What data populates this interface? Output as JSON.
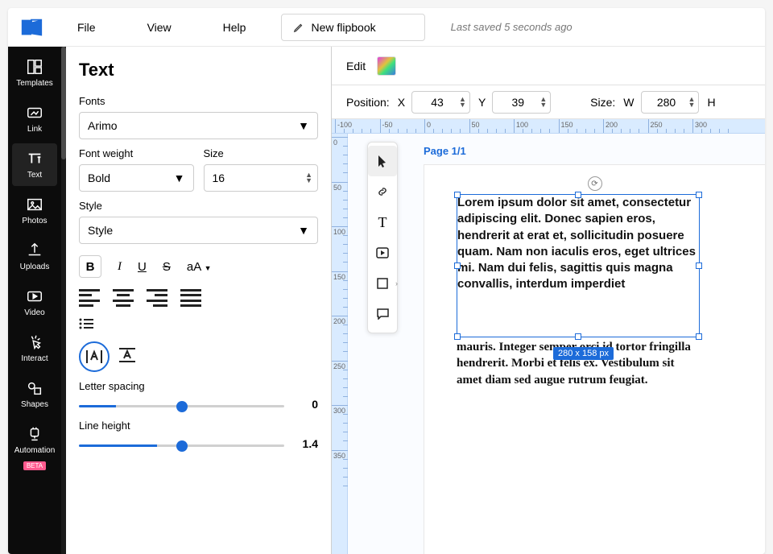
{
  "menubar": {
    "file": "File",
    "view": "View",
    "help": "Help",
    "new_flipbook": "New flipbook",
    "last_saved": "Last saved 5 seconds ago"
  },
  "sidebar": {
    "items": [
      {
        "id": "templates",
        "label": "Templates"
      },
      {
        "id": "link",
        "label": "Link"
      },
      {
        "id": "text",
        "label": "Text"
      },
      {
        "id": "photos",
        "label": "Photos"
      },
      {
        "id": "uploads",
        "label": "Uploads"
      },
      {
        "id": "video",
        "label": "Video"
      },
      {
        "id": "interact",
        "label": "Interact"
      },
      {
        "id": "shapes",
        "label": "Shapes"
      },
      {
        "id": "automation",
        "label": "Automation"
      }
    ],
    "beta_tag": "BETA",
    "active": "text"
  },
  "panel": {
    "title": "Text",
    "fonts_label": "Fonts",
    "font_value": "Arimo",
    "weight_label": "Font weight",
    "weight_value": "Bold",
    "size_label": "Size",
    "size_value": "16",
    "style_label": "Style",
    "style_value": "Style",
    "case_btn": "aA",
    "letter_label": "Letter spacing",
    "letter_value": "0",
    "line_label": "Line height",
    "line_value": "1.4"
  },
  "editbar": {
    "edit": "Edit"
  },
  "posbar": {
    "position": "Position:",
    "x": "X",
    "y": "Y",
    "size": "Size:",
    "w": "W",
    "h": "H",
    "x_val": "43",
    "y_val": "39",
    "w_val": "280"
  },
  "ruler_h": [
    "-100",
    "-50",
    "0",
    "50",
    "100",
    "150",
    "200",
    "250",
    "300"
  ],
  "ruler_v": [
    "0",
    "50",
    "100",
    "150",
    "200",
    "250",
    "300",
    "350"
  ],
  "canvas": {
    "page_label": "Page 1/1",
    "text_inside": "Lorem ipsum dolor sit amet, consectetur adipiscing elit. Donec sapien eros, hendrerit at erat et, sollicitudin posuere quam. Nam non iaculis eros, eget ultrices mi. Nam dui felis, sagittis quis magna convallis, interdum imperdiet",
    "text_overflow": "mauris. Integer semper orci id tortor fringilla hendrerit. Morbi et felis ex. Vestibulum sit amet diam sed augue rutrum feugiat.",
    "dim_badge": "280 x 158 px"
  }
}
